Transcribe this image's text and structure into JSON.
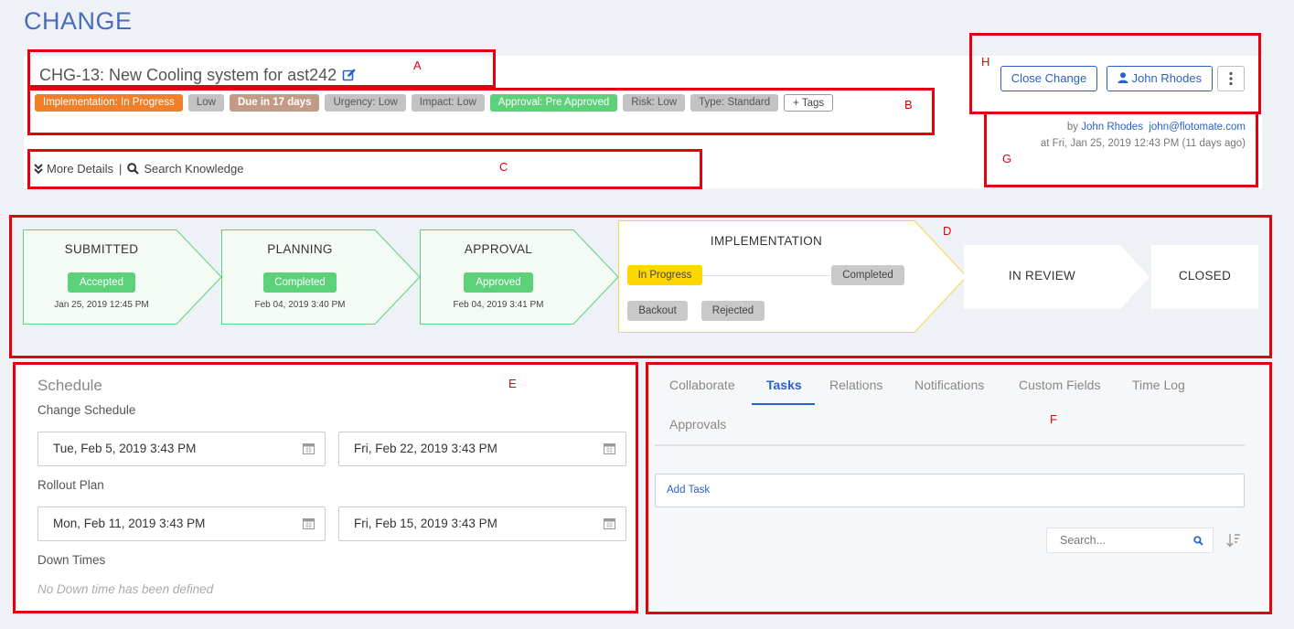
{
  "page": {
    "title": "CHANGE"
  },
  "change": {
    "title": "CHG-13: New Cooling system for ast242",
    "tags": [
      {
        "label": "Implementation: In Progress",
        "style": "orange"
      },
      {
        "label": "Low",
        "style": "grey"
      },
      {
        "label": "Due in 17 days",
        "style": "brown"
      },
      {
        "label": "Urgency: Low",
        "style": "grey"
      },
      {
        "label": "Impact: Low",
        "style": "grey"
      },
      {
        "label": "Approval: Pre Approved",
        "style": "green"
      },
      {
        "label": "Risk: Low",
        "style": "grey"
      },
      {
        "label": "Type: Standard",
        "style": "grey"
      },
      {
        "label": "+ Tags",
        "style": "outline"
      }
    ],
    "more_details": "More Details",
    "search_knowledge": "Search Knowledge",
    "close_button": "Close Change",
    "assignee_button": "John Rhodes",
    "meta": {
      "by_prefix": "by",
      "author": "John Rhodes",
      "email": "john@flotomate.com",
      "date_line": "at Fri, Jan 25, 2019 12:43 PM (11 days ago)"
    }
  },
  "stages": {
    "submitted": {
      "label": "SUBMITTED",
      "status": "Accepted",
      "date": "Jan 25, 2019 12:45 PM"
    },
    "planning": {
      "label": "PLANNING",
      "status": "Completed",
      "date": "Feb 04, 2019 3:40 PM"
    },
    "approval": {
      "label": "APPROVAL",
      "status": "Approved",
      "date": "Feb 04, 2019 3:41 PM"
    },
    "implementation": {
      "label": "IMPLEMENTATION",
      "in_progress": "In Progress",
      "completed": "Completed",
      "backout": "Backout",
      "rejected": "Rejected"
    },
    "in_review": {
      "label": "IN REVIEW"
    },
    "closed": {
      "label": "CLOSED"
    }
  },
  "schedule": {
    "title": "Schedule",
    "change_schedule_label": "Change Schedule",
    "change_start": "Tue, Feb 5, 2019 3:43 PM",
    "change_end": "Fri, Feb 22, 2019 3:43 PM",
    "rollout_label": "Rollout Plan",
    "rollout_start": "Mon, Feb 11, 2019 3:43 PM",
    "rollout_end": "Fri, Feb 15, 2019 3:43 PM",
    "down_times_label": "Down Times",
    "down_times_empty": "No Down time has been defined"
  },
  "tabs": {
    "items": [
      "Collaborate",
      "Tasks",
      "Relations",
      "Notifications",
      "Custom Fields",
      "Time Log",
      "Approvals"
    ],
    "active": "Tasks",
    "add_task": "Add Task",
    "search_placeholder": "Search..."
  },
  "callouts": {
    "a": "A",
    "b": "B",
    "c": "C",
    "d": "D",
    "e": "E",
    "f": "F",
    "g": "G",
    "h": "H"
  },
  "colors": {
    "accent": "#2b60c8",
    "annotation": "#e3000f",
    "success": "#5cd17a",
    "progress": "#ffd700",
    "priority": "#f07f2a"
  }
}
